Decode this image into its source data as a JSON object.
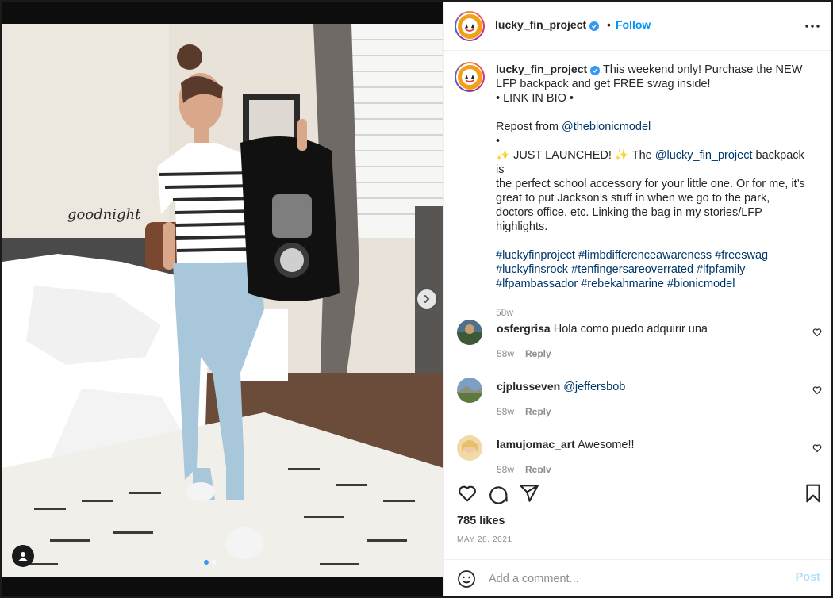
{
  "post": {
    "username": "lucky_fin_project",
    "follow_label": "Follow",
    "more_icon": "more-options-icon",
    "verified_icon": "verified-badge-icon"
  },
  "caption": {
    "username": "lucky_fin_project",
    "lines": [
      "This weekend only! Purchase the NEW",
      "LFP backpack and get FREE swag inside!",
      "• LINK IN BIO •",
      "",
      "Repost from ",
      "•",
      "✨ JUST LAUNCHED! ✨ The ",
      "the perfect school accessory for your little one. Or for me, it’s",
      "great to put Jackson’s stuff in when we go to the park,",
      "doctors office, etc. Linking the bag in my stories/LFP",
      "highlights.",
      "",
      "",
      "",
      ""
    ],
    "repost_mention": "@thebionicmodel",
    "launch_mention": "@lucky_fin_project",
    "launch_tail": " backpack is",
    "hashtags_line1": "#luckyfinproject #limbdifferenceawareness #freeswag",
    "hashtags_line2": "#luckyfinsrock #tenfingersareoverrated #lfpfamily",
    "hashtags_line3": "#lfpambassador #rebekahmarine #bionicmodel",
    "age": "58w"
  },
  "comments": [
    {
      "username": "osfergrisa",
      "text": "Hola como puedo adquirir una",
      "age": "58w",
      "reply_label": "Reply"
    },
    {
      "username": "cjplusseven",
      "text": "@jeffersbob",
      "age": "58w",
      "reply_label": "Reply"
    },
    {
      "username": "lamujomac_art",
      "text": "Awesome!!",
      "age": "58w",
      "reply_label": "Reply"
    }
  ],
  "actions": {
    "like_icon": "heart-icon",
    "comment_icon": "comment-icon",
    "share_icon": "share-icon",
    "save_icon": "bookmark-icon"
  },
  "likes": "785 likes",
  "date": "MAY 28, 2021",
  "comment_box": {
    "placeholder": "Add a comment...",
    "post_label": "Post",
    "emoji_icon": "emoji-icon"
  },
  "colors": {
    "accent": "#0095f6",
    "post_disabled": "#b2dffc",
    "mention": "#00376b",
    "meta": "#8e8e8e"
  }
}
